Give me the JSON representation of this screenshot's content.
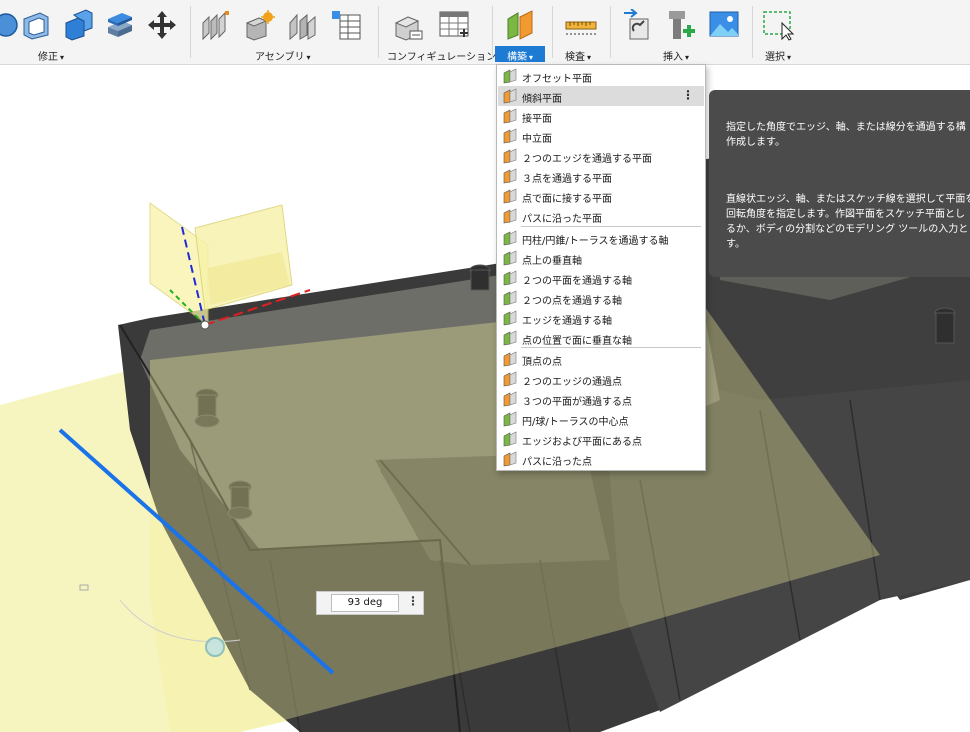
{
  "toolbar": {
    "groups": [
      {
        "label": "修正"
      },
      {
        "label": "アセンブリ"
      },
      {
        "label": "コンフィギュレーション"
      },
      {
        "label": "構築"
      },
      {
        "label": "検査"
      },
      {
        "label": "挿入"
      },
      {
        "label": "選択"
      }
    ],
    "caret": "▾",
    "active_group": "構築"
  },
  "construct_menu": {
    "items": [
      {
        "label": "オフセット平面",
        "icon": "offset-plane-icon"
      },
      {
        "label": "傾斜平面",
        "icon": "plane-at-angle-icon",
        "highlighted": true
      },
      {
        "label": "接平面",
        "icon": "tangent-plane-icon"
      },
      {
        "label": "中立面",
        "icon": "midplane-icon"
      },
      {
        "label": "２つのエッジを通過する平面",
        "icon": "plane-through-two-edges-icon"
      },
      {
        "label": "３点を通過する平面",
        "icon": "plane-through-three-points-icon"
      },
      {
        "label": "点で面に接する平面",
        "icon": "plane-tangent-at-point-icon"
      },
      {
        "label": "パスに沿った平面",
        "icon": "plane-along-path-icon"
      },
      {
        "label": "円柱/円錐/トーラスを通過する軸",
        "icon": "axis-through-cylinder-icon"
      },
      {
        "label": "点上の垂直軸",
        "icon": "axis-perpendicular-at-point-icon"
      },
      {
        "label": "２つの平面を通過する軸",
        "icon": "axis-through-two-planes-icon"
      },
      {
        "label": "２つの点を通過する軸",
        "icon": "axis-through-two-points-icon"
      },
      {
        "label": "エッジを通過する軸",
        "icon": "axis-through-edge-icon"
      },
      {
        "label": "点の位置で面に垂直な軸",
        "icon": "axis-perpendicular-to-face-icon"
      },
      {
        "label": "頂点の点",
        "icon": "point-at-vertex-icon"
      },
      {
        "label": "２つのエッジの通過点",
        "icon": "point-through-two-edges-icon"
      },
      {
        "label": "３つの平面が通過する点",
        "icon": "point-through-three-planes-icon"
      },
      {
        "label": "円/球/トーラスの中心点",
        "icon": "point-at-center-icon"
      },
      {
        "label": "エッジおよび平面にある点",
        "icon": "point-at-edge-and-plane-icon"
      },
      {
        "label": "パスに沿った点",
        "icon": "point-along-path-icon"
      }
    ],
    "more_icon": "⋮"
  },
  "tooltip": {
    "para1": "指定した角度でエッジ、軸、または線分を通過する構\n作成します。",
    "para2": "直線状エッジ、軸、またはスケッチ線を選択して平面を\n回転角度を指定します。作図平面をスケッチ平面とし\nるか、ボディの分割などのモデリング ツールの入力とし\nす。"
  },
  "angle_input": {
    "value": "93 deg",
    "more_icon": "⋮"
  },
  "colors": {
    "accent": "#1e7bd3",
    "plane_fill": "#f5f3b0",
    "model_dark": "#3a3a3a",
    "tooltip_bg": "#4b4b4b"
  }
}
